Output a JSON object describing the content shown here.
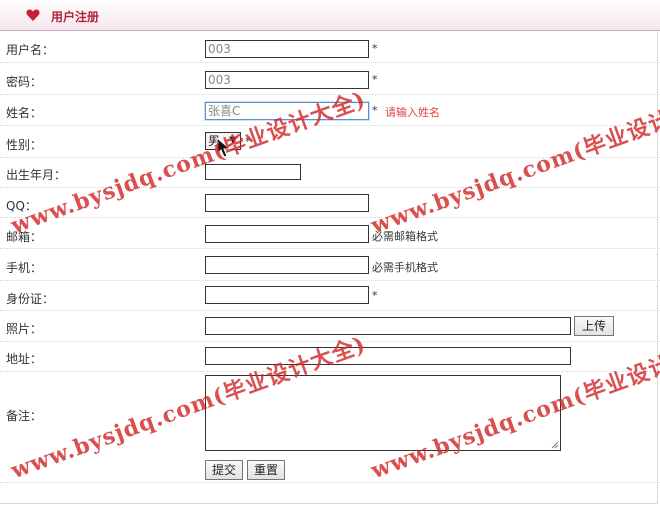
{
  "header": {
    "title": "用户注册",
    "icon": "heart-icon",
    "accent": "#b4223a"
  },
  "form": {
    "username": {
      "label": "用户名：",
      "value": "003",
      "required": "*"
    },
    "password": {
      "label": "密码：",
      "value": "003",
      "required": "*"
    },
    "realname": {
      "label": "姓名：",
      "value": "张喜C",
      "required": "*",
      "hint": "请输入姓名",
      "hint_color": "#d44"
    },
    "gender": {
      "label": "性别：",
      "value": "男",
      "required": "*"
    },
    "birthdate": {
      "label": "出生年月：",
      "value": ""
    },
    "qq": {
      "label": "QQ：",
      "value": ""
    },
    "email": {
      "label": "邮箱：",
      "value": "",
      "hint": "必需邮箱格式"
    },
    "mobile": {
      "label": "手机：",
      "value": "",
      "hint": "必需手机格式"
    },
    "idcard": {
      "label": "身份证：",
      "value": "",
      "required": "*"
    },
    "photo": {
      "label": "照片：",
      "value": "",
      "button": "上传"
    },
    "address": {
      "label": "地址：",
      "value": ""
    },
    "remark": {
      "label": "备注：",
      "value": ""
    }
  },
  "actions": {
    "submit": "提交",
    "reset": "重置"
  },
  "watermark": {
    "text": "www.bysjdq.com(毕业设计大全)"
  }
}
